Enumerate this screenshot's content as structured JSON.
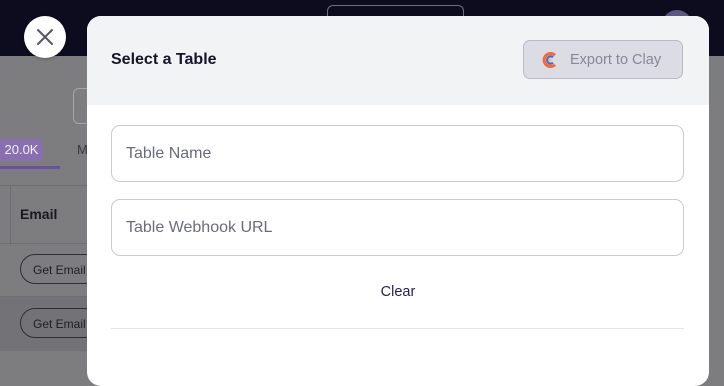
{
  "background": {
    "badge": "20.0K",
    "tab2": "M",
    "table_header": "Email",
    "get_email_labels": [
      "Get Email",
      "Get Email"
    ]
  },
  "modal": {
    "title": "Select a Table",
    "export_button": {
      "label": "Export to Clay",
      "icon": "clay-logo-icon"
    },
    "fields": {
      "table_name_placeholder": "Table Name",
      "webhook_placeholder": "Table Webhook URL"
    },
    "clear_label": "Clear"
  },
  "close_button": {
    "icon": "close-icon"
  },
  "colors": {
    "accent": "#6b4fa3",
    "title": "#14142b",
    "clear": "#1f2152"
  }
}
